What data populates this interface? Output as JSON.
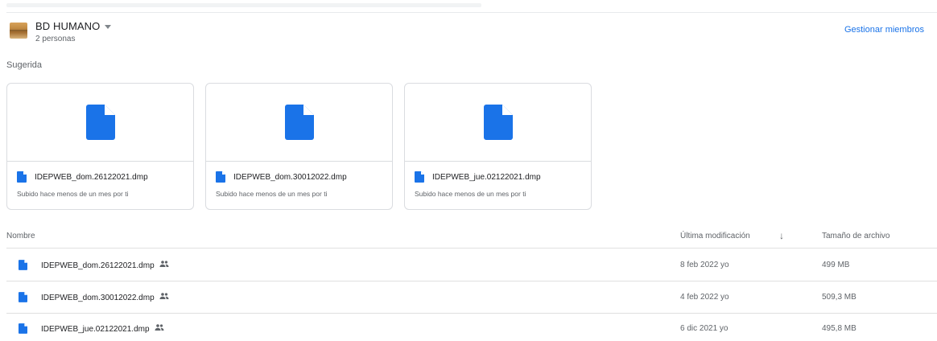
{
  "drive": {
    "name": "BD HUMANO",
    "members": "2 personas",
    "manage_members": "Gestionar miembros"
  },
  "suggested": {
    "title": "Sugerida",
    "cards": [
      {
        "name": "IDEPWEB_dom.26122021.dmp",
        "subtitle": "Subido hace menos de un mes por ti"
      },
      {
        "name": "IDEPWEB_dom.30012022.dmp",
        "subtitle": "Subido hace menos de un mes por ti"
      },
      {
        "name": "IDEPWEB_jue.02122021.dmp",
        "subtitle": "Subido hace menos de un mes por ti"
      }
    ]
  },
  "list": {
    "headers": {
      "name": "Nombre",
      "modified": "Última modificación",
      "sort_icon": "arrow-down-icon",
      "size": "Tamaño de archivo"
    },
    "rows": [
      {
        "name": "IDEPWEB_dom.26122021.dmp",
        "modified": "8 feb 2022 yo",
        "size": "499 MB"
      },
      {
        "name": "IDEPWEB_dom.30012022.dmp",
        "modified": "4 feb 2022 yo",
        "size": "509,3 MB"
      },
      {
        "name": "IDEPWEB_jue.02122021.dmp",
        "modified": "6 dic 2021 yo",
        "size": "495,8 MB"
      }
    ]
  },
  "colors": {
    "accent": "#1a73e8",
    "text_secondary": "#5f6368"
  }
}
